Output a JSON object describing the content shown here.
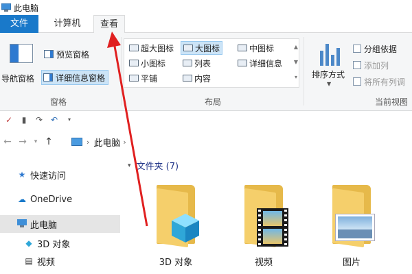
{
  "window": {
    "title": "此电脑"
  },
  "tabs": [
    {
      "label": "文件"
    },
    {
      "label": "计算机"
    },
    {
      "label": "查看"
    }
  ],
  "ribbon": {
    "panes": {
      "navigation_pane": "导航窗格",
      "preview_pane": "预览窗格",
      "details_pane": "详细信息窗格",
      "group_label": "窗格"
    },
    "layout": {
      "items": [
        {
          "label": "超大图标"
        },
        {
          "label": "大图标"
        },
        {
          "label": "中图标"
        },
        {
          "label": "小图标"
        },
        {
          "label": "列表"
        },
        {
          "label": "详细信息"
        },
        {
          "label": "平铺"
        },
        {
          "label": "内容"
        }
      ],
      "group_label": "布局"
    },
    "current_view": {
      "sort_by": "排序方式",
      "group_by": "分组依据",
      "add_columns": "添加列",
      "size_all_columns": "将所有列调",
      "group_label": "当前视图"
    }
  },
  "address": {
    "location": "此电脑"
  },
  "nav_pane": {
    "items": [
      {
        "label": "快速访问"
      },
      {
        "label": "OneDrive"
      },
      {
        "label": "此电脑"
      },
      {
        "label": "3D 对象"
      },
      {
        "label": "视频"
      }
    ]
  },
  "content": {
    "group_header": "文件夹 (7)",
    "folders": [
      {
        "label": "3D 对象"
      },
      {
        "label": "视频"
      },
      {
        "label": "图片"
      }
    ]
  },
  "colors": {
    "accent": "#1979ca",
    "selection": "#cce4f7",
    "annotation_arrow": "#e02020"
  }
}
